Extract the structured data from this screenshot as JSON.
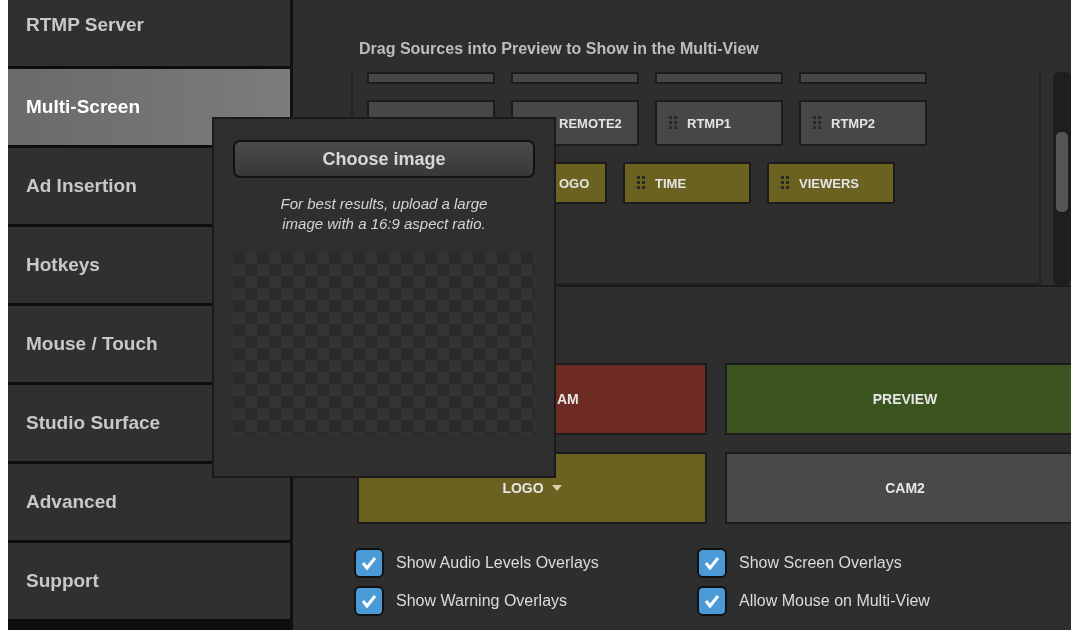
{
  "sidebar": {
    "items": [
      {
        "label": "RTMP Server",
        "selected": false
      },
      {
        "label": "Multi-Screen",
        "selected": true
      },
      {
        "label": "Ad Insertion",
        "selected": false
      },
      {
        "label": "Hotkeys",
        "selected": false
      },
      {
        "label": "Mouse / Touch",
        "selected": false
      },
      {
        "label": "Studio Surface",
        "selected": false
      },
      {
        "label": "Advanced",
        "selected": false
      },
      {
        "label": "Support",
        "selected": false
      }
    ]
  },
  "sources": {
    "title": "Drag Sources into Preview to Show in the Multi-View",
    "rows": [
      [
        {
          "color": "#474747"
        },
        {
          "color": "#474747"
        },
        {
          "color": "#474747"
        },
        {
          "color": "#474747"
        }
      ],
      [
        {
          "color": "#474747"
        },
        {
          "label": "REMOTE2",
          "color": "#474747"
        },
        {
          "label": "RTMP1",
          "color": "#474747"
        },
        {
          "label": "RTMP2",
          "color": "#474747"
        }
      ],
      [
        "",
        {
          "label": "OGO",
          "color": "#6b6222"
        },
        {
          "label": "TIME",
          "color": "#6b6222"
        },
        {
          "label": "VIEWERS",
          "color": "#6b6222"
        }
      ]
    ]
  },
  "layout": {
    "buttons": [
      {
        "label": "AM",
        "color": "#6c2a22",
        "dropdown": false
      },
      {
        "label": "PREVIEW",
        "color": "#3c5520",
        "dropdown": false
      },
      {
        "label": "LOGO",
        "color": "#6b6222",
        "dropdown": true
      },
      {
        "label": "CAM2",
        "color": "#494949",
        "dropdown": false
      }
    ]
  },
  "options": [
    {
      "label": "Show Audio Levels Overlays",
      "checked": true
    },
    {
      "label": "Show Screen Overlays",
      "checked": true
    },
    {
      "label": "Show Warning Overlays",
      "checked": true
    },
    {
      "label": "Allow Mouse on Multi-View",
      "checked": true
    }
  ],
  "popup": {
    "button": "Choose image",
    "hint": "For best results, upload a large image with a 16:9 aspect ratio."
  }
}
